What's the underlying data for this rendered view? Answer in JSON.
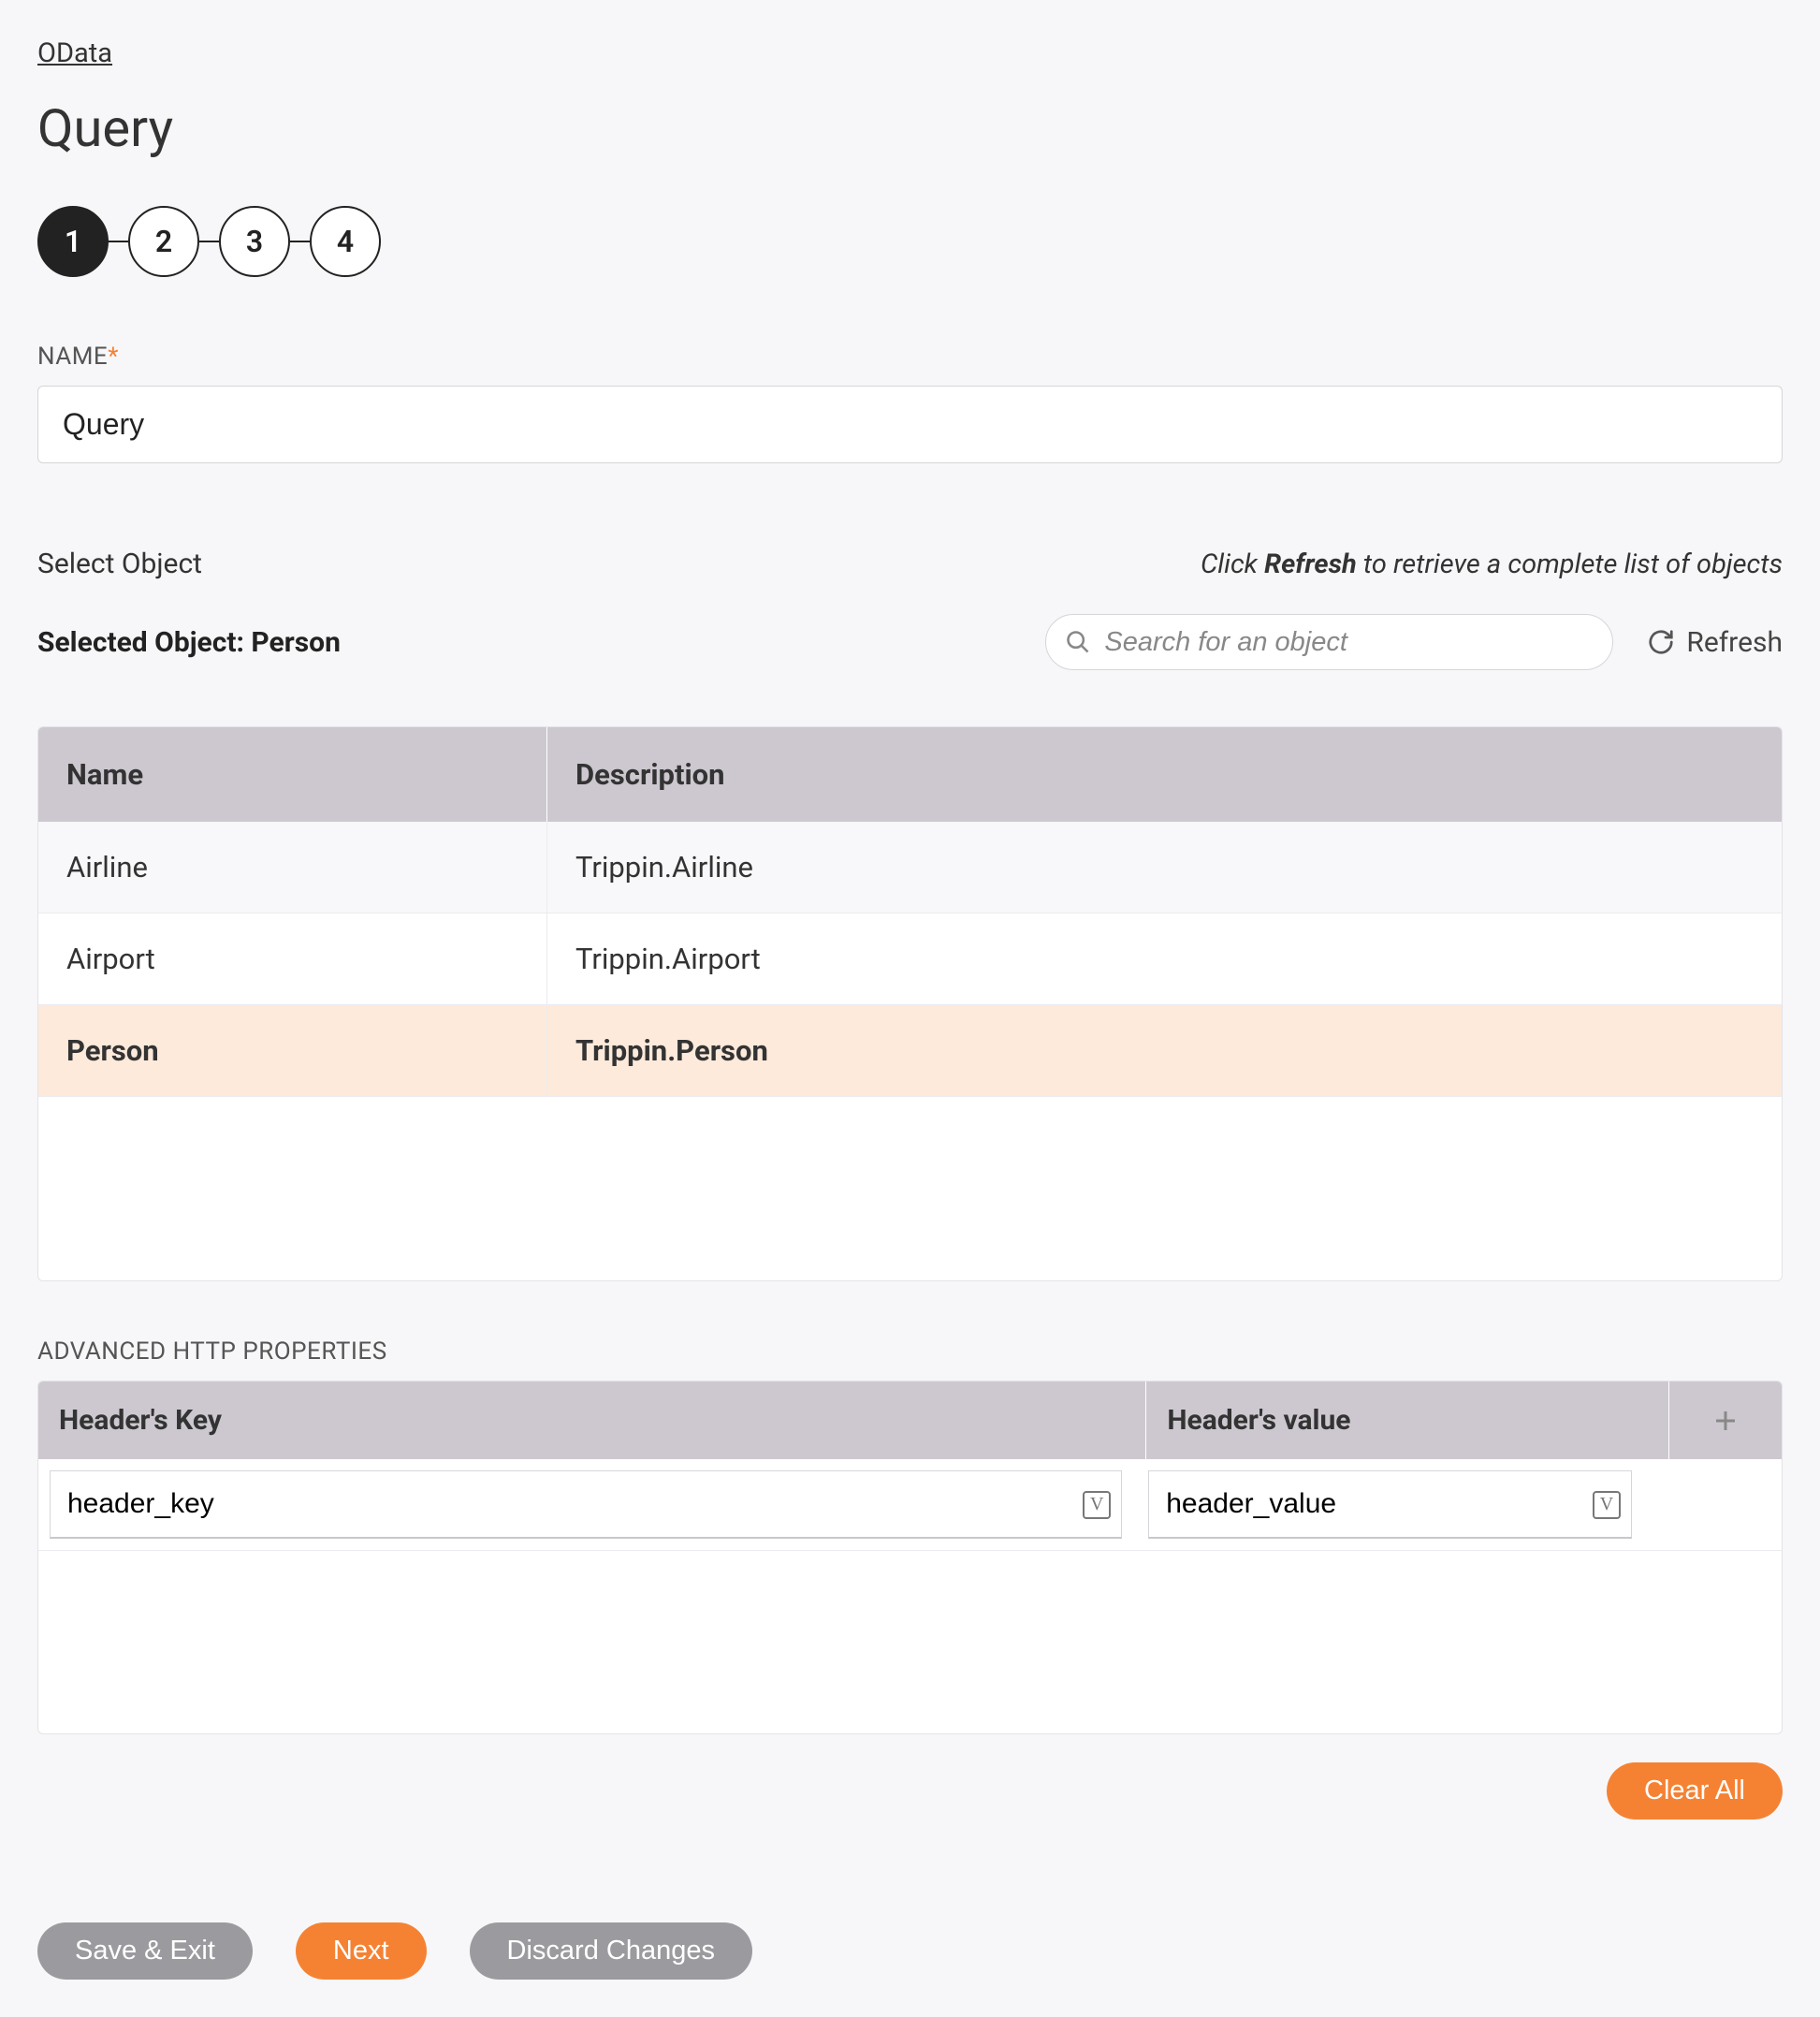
{
  "breadcrumb": "OData",
  "page_title": "Query",
  "stepper": {
    "steps": [
      "1",
      "2",
      "3",
      "4"
    ],
    "active": 0
  },
  "name_field": {
    "label": "NAME",
    "required": "*",
    "value": "Query"
  },
  "select_object": {
    "label": "Select Object",
    "hint_prefix": "Click ",
    "hint_bold": "Refresh",
    "hint_suffix": " to retrieve a complete list of objects",
    "selected_prefix": "Selected Object: ",
    "selected_value": "Person",
    "search_placeholder": "Search for an object",
    "refresh_label": "Refresh"
  },
  "objects_table": {
    "columns": {
      "name": "Name",
      "description": "Description"
    },
    "rows": [
      {
        "name": "Airline",
        "description": "Trippin.Airline",
        "alt": true,
        "selected": false
      },
      {
        "name": "Airport",
        "description": "Trippin.Airport",
        "alt": false,
        "selected": false
      },
      {
        "name": "Person",
        "description": "Trippin.Person",
        "alt": false,
        "selected": true
      }
    ]
  },
  "advanced": {
    "label": "ADVANCED HTTP PROPERTIES",
    "columns": {
      "key": "Header's Key",
      "value": "Header's value"
    },
    "row": {
      "key": "header_key",
      "value": "header_value"
    },
    "v_badge": "V"
  },
  "buttons": {
    "clear_all": "Clear All",
    "save_exit": "Save & Exit",
    "next": "Next",
    "discard": "Discard Changes"
  }
}
